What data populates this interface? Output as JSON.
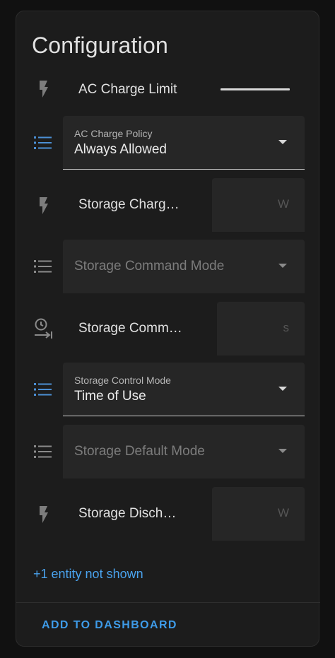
{
  "card": {
    "title": "Configuration",
    "more_entities": "+1 entity not shown",
    "add_button": "ADD TO DASHBOARD"
  },
  "rows": [
    {
      "icon": "flash-icon",
      "label": "AC Charge Limit",
      "type": "slider"
    },
    {
      "icon": "list-icon",
      "label": "AC Charge Policy",
      "type": "select",
      "value": "Always Allowed"
    },
    {
      "icon": "flash-icon",
      "label": "Storage Charg…",
      "type": "number",
      "unit": "W"
    },
    {
      "icon": "list-icon",
      "label": "Storage Command Mode",
      "type": "select",
      "value": ""
    },
    {
      "icon": "timer-icon",
      "label": "Storage Comm…",
      "type": "number",
      "unit": "s"
    },
    {
      "icon": "list-icon",
      "label": "Storage Control Mode",
      "type": "select",
      "value": "Time of Use"
    },
    {
      "icon": "list-icon",
      "label": "Storage Default Mode",
      "type": "select",
      "value": ""
    },
    {
      "icon": "flash-icon",
      "label": "Storage Disch…",
      "type": "number",
      "unit": "W"
    }
  ],
  "colors": {
    "accent": "#3e9be8",
    "icon_active": "#4b8fd4",
    "icon_inactive": "#8a8a8a",
    "card_bg": "#1c1c1c"
  }
}
